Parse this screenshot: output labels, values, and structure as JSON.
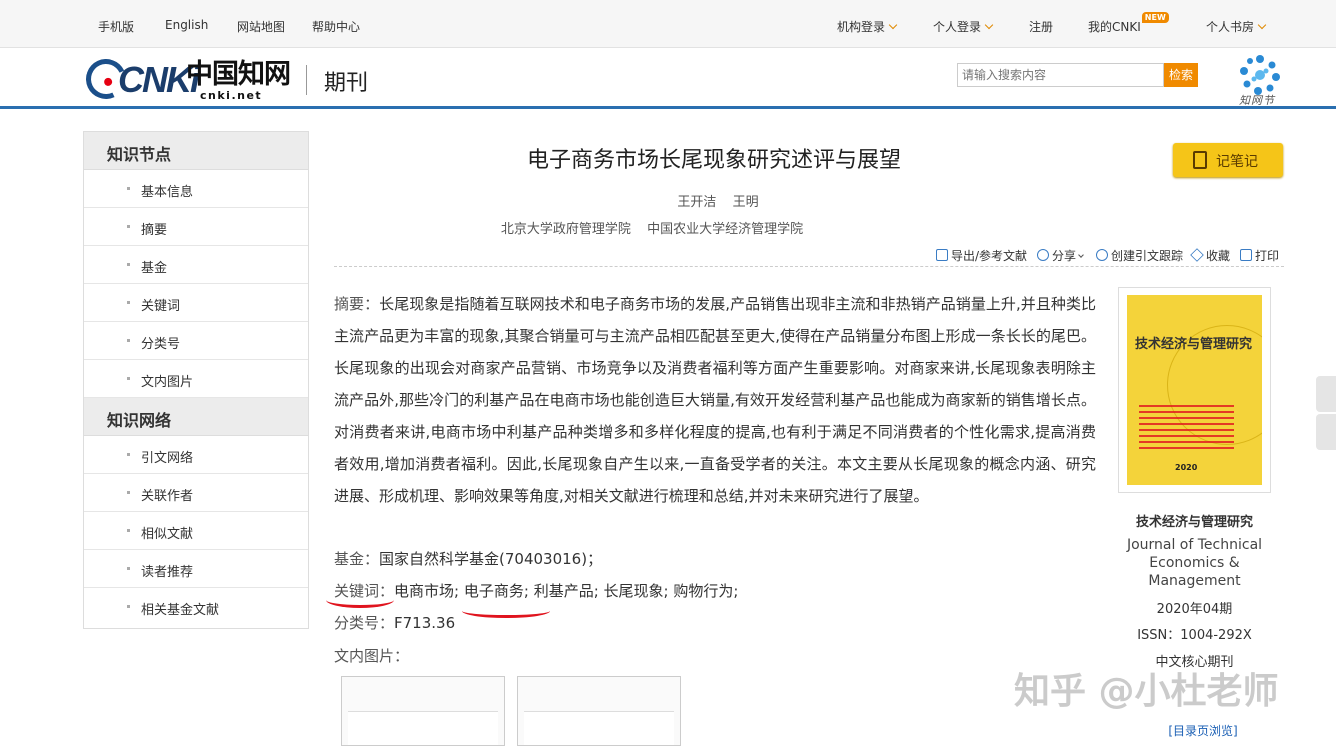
{
  "topbar": {
    "mobile": "手机版",
    "english": "English",
    "sitemap": "网站地图",
    "help": "帮助中心",
    "institution_login": "机构登录",
    "personal_login": "个人登录",
    "register": "注册",
    "my_cnki": "我的CNKI",
    "new_badge": "NEW",
    "bookroom": "个人书房"
  },
  "header": {
    "logo_latin": "CNKi",
    "logo_cn": "中国知网",
    "logo_url": "cnki.net",
    "section": "期刊",
    "search_placeholder": "请输入搜索内容",
    "search_button": "检索",
    "zhiwang_logo_text": "知网节"
  },
  "sidebar": {
    "group1": "知识节点",
    "group1_items": [
      "基本信息",
      "摘要",
      "基金",
      "关键词",
      "分类号",
      "文内图片"
    ],
    "group2": "知识网络",
    "group2_items": [
      "引文网络",
      "关联作者",
      "相似文献",
      "读者推荐",
      "相关基金文献"
    ]
  },
  "article": {
    "title": "电子商务市场长尾现象研究述评与展望",
    "note_button": "记笔记",
    "authors": [
      "王开洁",
      "王明"
    ],
    "orgs": [
      "北京大学政府管理学院",
      "中国农业大学经济管理学院"
    ],
    "tools": [
      "导出/参考文献",
      "分享",
      "创建引文跟踪",
      "收藏",
      "打印"
    ],
    "abstract_label": "摘要：",
    "abstract": "长尾现象是指随着互联网技术和电子商务市场的发展,产品销售出现非主流和非热销产品销量上升,并且种类比主流产品更为丰富的现象,其聚合销量可与主流产品相匹配甚至更大,使得在产品销量分布图上形成一条长长的尾巴。长尾现象的出现会对商家产品营销、市场竞争以及消费者福利等方面产生重要影响。对商家来讲,长尾现象表明除主流产品外,那些冷门的利基产品在电商市场也能创造巨大销量,有效开发经营利基产品也能成为商家新的销售增长点。对消费者来讲,电商市场中利基产品种类增多和多样化程度的提高,也有利于满足不同消费者的个性化需求,提高消费者效用,增加消费者福利。因此,长尾现象自产生以来,一直备受学者的关注。本文主要从长尾现象的概念内涵、研究进展、形成机理、影响效果等角度,对相关文献进行梳理和总结,并对未来研究进行了展望。",
    "fund_label": "基金：",
    "fund": "国家自然科学基金(70403016)；",
    "keywords_label": "关键词：",
    "keywords": [
      "电商市场;",
      "电子商务;",
      "利基产品;",
      "长尾现象;",
      "购物行为;"
    ],
    "class_label": "分类号：",
    "class_code": "F713.36",
    "figures_label": "文内图片："
  },
  "journal": {
    "cover_title": "技术经济与管理研究",
    "cover_year": "2020",
    "name": "技术经济与管理研究",
    "name_en": "Journal of Technical Economics & Management",
    "issue": "2020年04期",
    "issn": "ISSN：1004-292X",
    "core": "中文核心期刊",
    "toc_link": "[目录页浏览]"
  },
  "watermark": "知乎 @小杜老师",
  "colors": {
    "accent_orange": "#f08a00",
    "brand_blue": "#2a6fb0",
    "note_yellow": "#f5c518",
    "annotation_red": "#e0141e"
  }
}
